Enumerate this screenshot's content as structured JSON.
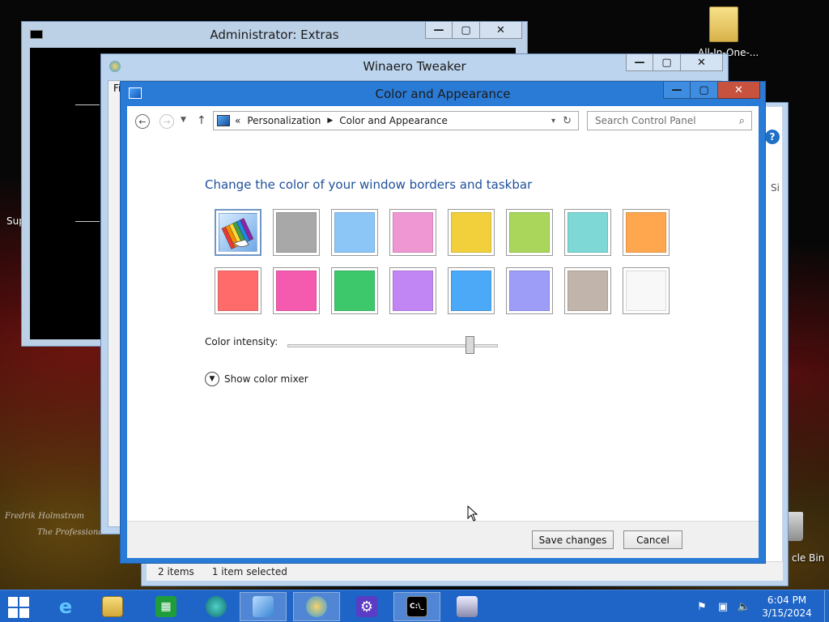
{
  "desktop": {
    "folder_label": "All-In-One-...",
    "bin_label": "cle Bin",
    "sup_label": "Sup",
    "signature_line1": "Fredrik Holmstrom",
    "signature_line2": "The Professional"
  },
  "admin_window": {
    "title": "Administrator:  Extras",
    "icon": "cmd-icon"
  },
  "winaero_window": {
    "title": "Winaero Tweaker",
    "icon": "winaero-icon",
    "menu_fragment": "Fi"
  },
  "back_explorer": {
    "status_items": "2 items",
    "status_selected": "1 item selected",
    "help": "?",
    "side_fragment": "Si"
  },
  "main_window": {
    "title": "Color and Appearance",
    "nav": {
      "back": "back-arrow-icon",
      "forward": "forward-arrow-icon",
      "up": "up-arrow-icon"
    },
    "address": {
      "prefix": "«",
      "crumb1": "Personalization",
      "crumb2": "Color and Appearance"
    },
    "search_placeholder": "Search Control Panel",
    "heading": "Change the color of your window borders and taskbar",
    "swatch_colors": [
      {
        "name": "automatic",
        "color": "#5b93d9"
      },
      {
        "name": "gray",
        "color": "#a8a8a8"
      },
      {
        "name": "sky-blue",
        "color": "#8cc6f7"
      },
      {
        "name": "pink",
        "color": "#ef97d2"
      },
      {
        "name": "yellow",
        "color": "#f1d03c"
      },
      {
        "name": "lime",
        "color": "#a9d65b"
      },
      {
        "name": "turquoise",
        "color": "#7dd8d6"
      },
      {
        "name": "orange",
        "color": "#ffa74f"
      },
      {
        "name": "red",
        "color": "#ff6b6b"
      },
      {
        "name": "magenta",
        "color": "#f45bae"
      },
      {
        "name": "green",
        "color": "#3ec86c"
      },
      {
        "name": "purple",
        "color": "#c286f4"
      },
      {
        "name": "blue",
        "color": "#4ba9f7"
      },
      {
        "name": "periwinkle",
        "color": "#9d9cf7"
      },
      {
        "name": "taupe",
        "color": "#c1b4aa"
      },
      {
        "name": "white",
        "color": "#f8f8f8"
      }
    ],
    "intensity_label": "Color intensity:",
    "intensity_value": 0.87,
    "mixer_label": "Show color mixer",
    "save_label": "Save changes",
    "cancel_label": "Cancel"
  },
  "taskbar": {
    "apps": [
      "internet-explorer-icon",
      "file-explorer-icon",
      "store-icon",
      "app-icon",
      "control-panel-icon",
      "winaero-icon",
      "settings-icon",
      "cmd-icon",
      "network-icon"
    ],
    "time": "6:04 PM",
    "date": "3/15/2024"
  }
}
